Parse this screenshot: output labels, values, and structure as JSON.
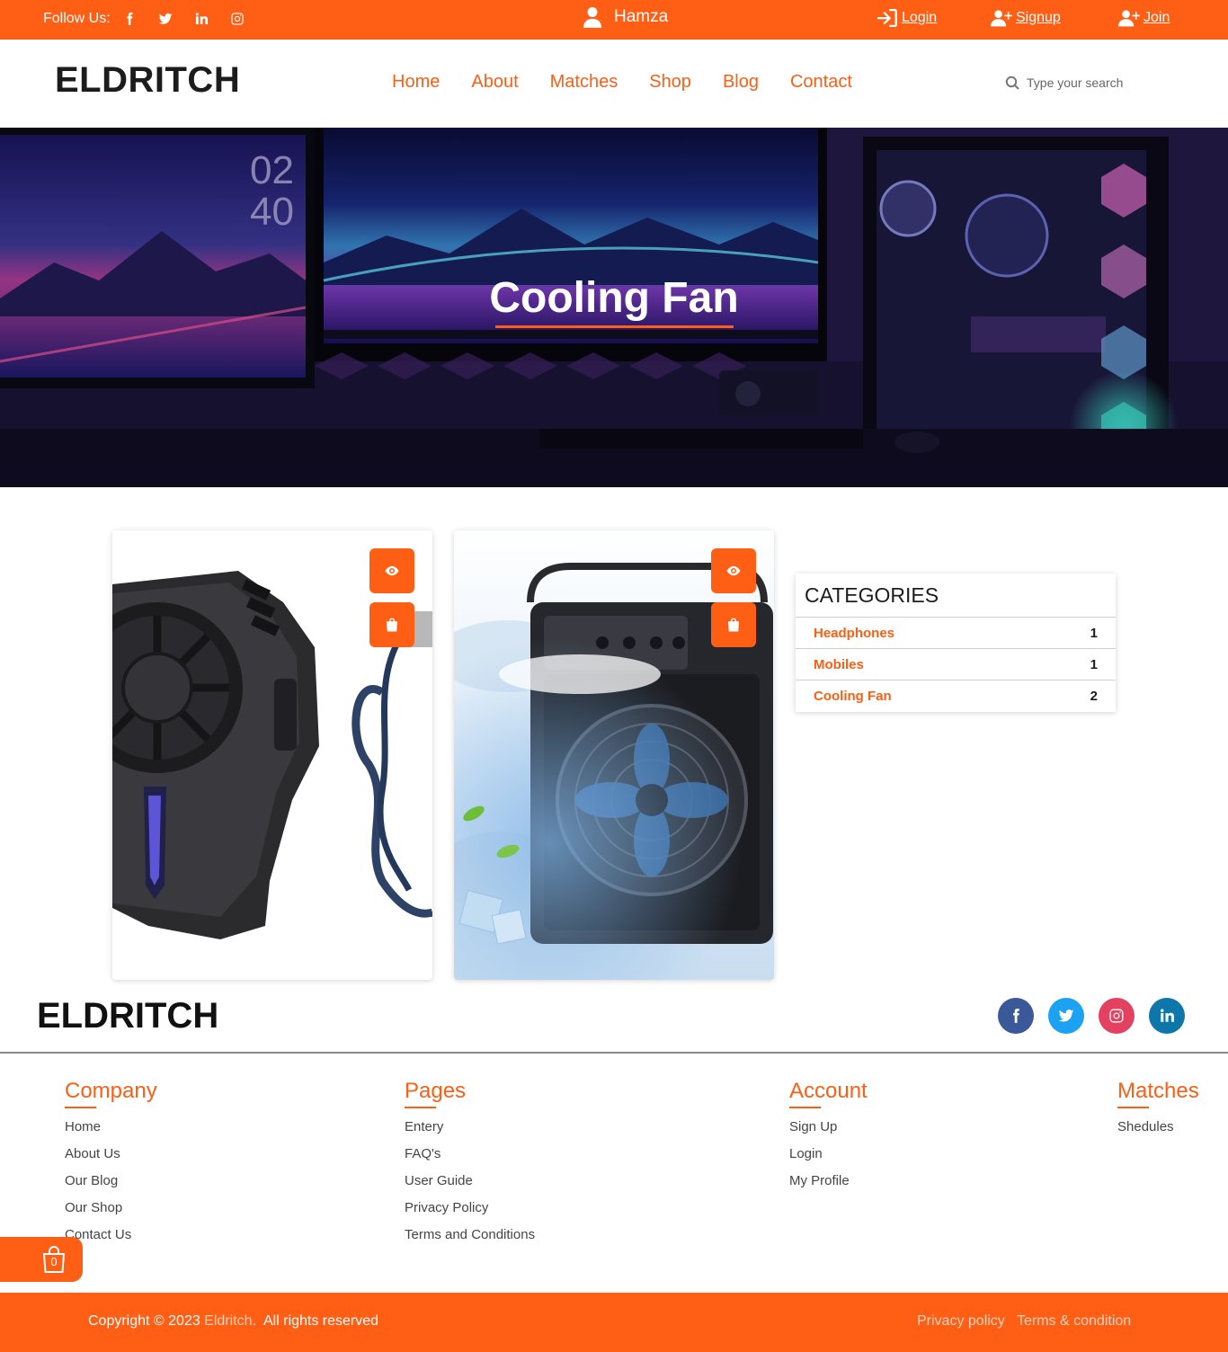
{
  "topbar": {
    "follow_label": "Follow Us:",
    "social_icons": [
      "facebook-icon",
      "twitter-icon",
      "linkedin-icon",
      "instagram-icon"
    ],
    "username": "Hamza",
    "login": "Login",
    "signup": "Signup",
    "join": "Join"
  },
  "header": {
    "logo": "ELDRITCH",
    "nav": [
      "Home",
      "About",
      "Matches",
      "Shop",
      "Blog",
      "Contact"
    ],
    "search_placeholder": "Type your search"
  },
  "hero": {
    "title": "Cooling Fan"
  },
  "products": [
    {
      "name": "phone-cooler-product",
      "actions": [
        "view-icon",
        "bag-icon"
      ]
    },
    {
      "name": "air-cooler-fan-product",
      "actions": [
        "view-icon",
        "bag-icon"
      ]
    }
  ],
  "categories": {
    "title": "CATEGORIES",
    "items": [
      {
        "name": "Headphones",
        "count": "1"
      },
      {
        "name": "Mobiles",
        "count": "1"
      },
      {
        "name": "Cooling Fan",
        "count": "2"
      }
    ]
  },
  "footer": {
    "logo": "ELDRITCH",
    "social_icons": [
      "facebook-icon",
      "twitter-icon",
      "instagram-icon",
      "linkedin-icon"
    ],
    "columns": [
      {
        "title": "Company",
        "links": [
          "Home",
          "About Us",
          "Our Blog",
          "Our Shop",
          "Contact Us"
        ]
      },
      {
        "title": "Pages",
        "links": [
          "Entery",
          "FAQ's",
          "User Guide",
          "Privacy Policy",
          "Terms and Conditions"
        ]
      },
      {
        "title": "Account",
        "links": [
          "Sign Up",
          "Login",
          "My Profile"
        ]
      },
      {
        "title": "Matches",
        "links": [
          "Shedules"
        ]
      }
    ],
    "cart_count": "0",
    "copyright_prefix": "Copyright © 2023 ",
    "copyright_brand": "Eldritch.",
    "copyright_suffix": "  All rights reserved",
    "privacy": "Privacy policy",
    "terms": "Terms & condition"
  },
  "colors": {
    "accent": "#ff5e14",
    "facebook": "#3b5998",
    "twitter": "#1da1f2",
    "instagram": "#e4405f",
    "linkedin": "#0e76a8"
  }
}
